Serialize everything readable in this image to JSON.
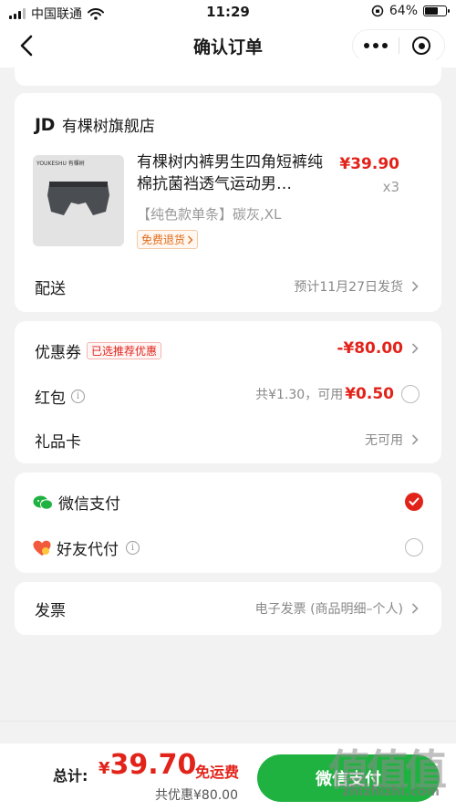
{
  "status_bar": {
    "carrier": "中国联通",
    "time": "11:29",
    "battery": "64%",
    "battery_level": 0.64
  },
  "navbar": {
    "title": "确认订单"
  },
  "shop": {
    "logo": "JD",
    "name": "有棵树旗舰店"
  },
  "product": {
    "image_brand": "YOUKESHU 有棵树",
    "title": "有棵树内裤男生四角短裤纯棉抗菌裆透气运动男…",
    "price": "¥39.90",
    "qty": "x3",
    "spec": "【纯色款单条】碳灰,XL",
    "return_tag": "免费退货"
  },
  "delivery": {
    "label": "配送",
    "value": "预计11月27日发货"
  },
  "coupon": {
    "label": "优惠券",
    "tag": "已选推荐优惠",
    "value": "-¥80.00"
  },
  "red_packet": {
    "label": "红包",
    "total": "共¥1.30，可用",
    "usable": "¥0.50"
  },
  "gift_card": {
    "label": "礼品卡",
    "value": "无可用"
  },
  "payment": {
    "wechat_label": "微信支付",
    "friend_label": "好友代付",
    "selected": "wechat"
  },
  "invoice": {
    "label": "发票",
    "value": "电子发票 (商品明细–个人)"
  },
  "bottom": {
    "total_label": "总计:",
    "currency": "¥",
    "total": "39.70",
    "free_shipping": "免运费",
    "saved": "共优惠¥80.00",
    "pay_button": "微信支付"
  },
  "watermark": {
    "main": "值值值",
    "sub": "zhizhizhi.com"
  },
  "colors": {
    "accent_red": "#e2231a",
    "wechat_green": "#20b240"
  }
}
